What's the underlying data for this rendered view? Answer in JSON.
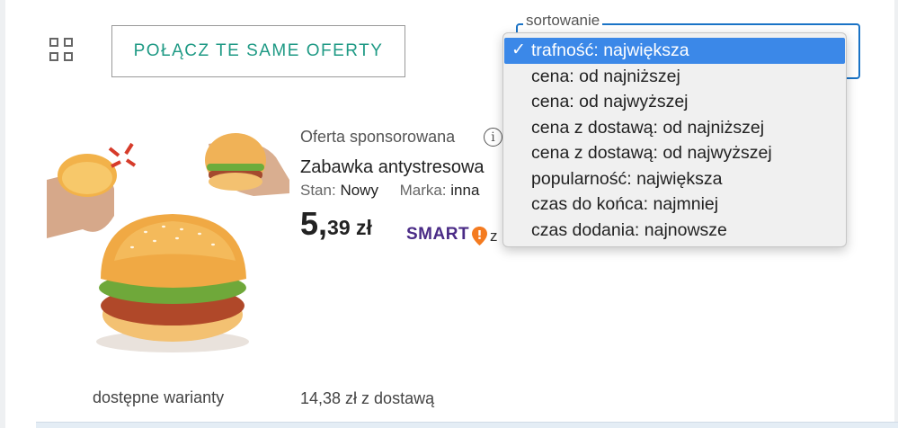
{
  "toolbar": {
    "view_icon": "grid-icon",
    "merge_button_label": "POŁĄCZ TE SAME OFERTY"
  },
  "sort": {
    "label": "sortowanie",
    "selected_index": 0,
    "accent_color": "#3b88e8",
    "check_mark": "✓",
    "options": [
      "trafność: największa",
      "cena: od najniższej",
      "cena: od najwyższej",
      "cena z dostawą: od najniższej",
      "cena z dostawą: od najwyższej",
      "popularność: największa",
      "czas do końca: najmniej",
      "czas dodania: najnowsze"
    ]
  },
  "product": {
    "sponsored_label": "Oferta sponsorowana",
    "info_icon": "i",
    "title": "Zabawka antystresowa",
    "condition_label": "Stan:",
    "condition_value": "Nowy",
    "brand_label": "Marka:",
    "brand_value": "inna",
    "price_main": "5,",
    "price_fraction": "39 zł",
    "smart_label": "SMART",
    "smart_suffix": "z",
    "brand_color": "#4a2b86",
    "variants_label": "dostępne warianty",
    "delivery_price": "14,38 zł z dostawą"
  }
}
